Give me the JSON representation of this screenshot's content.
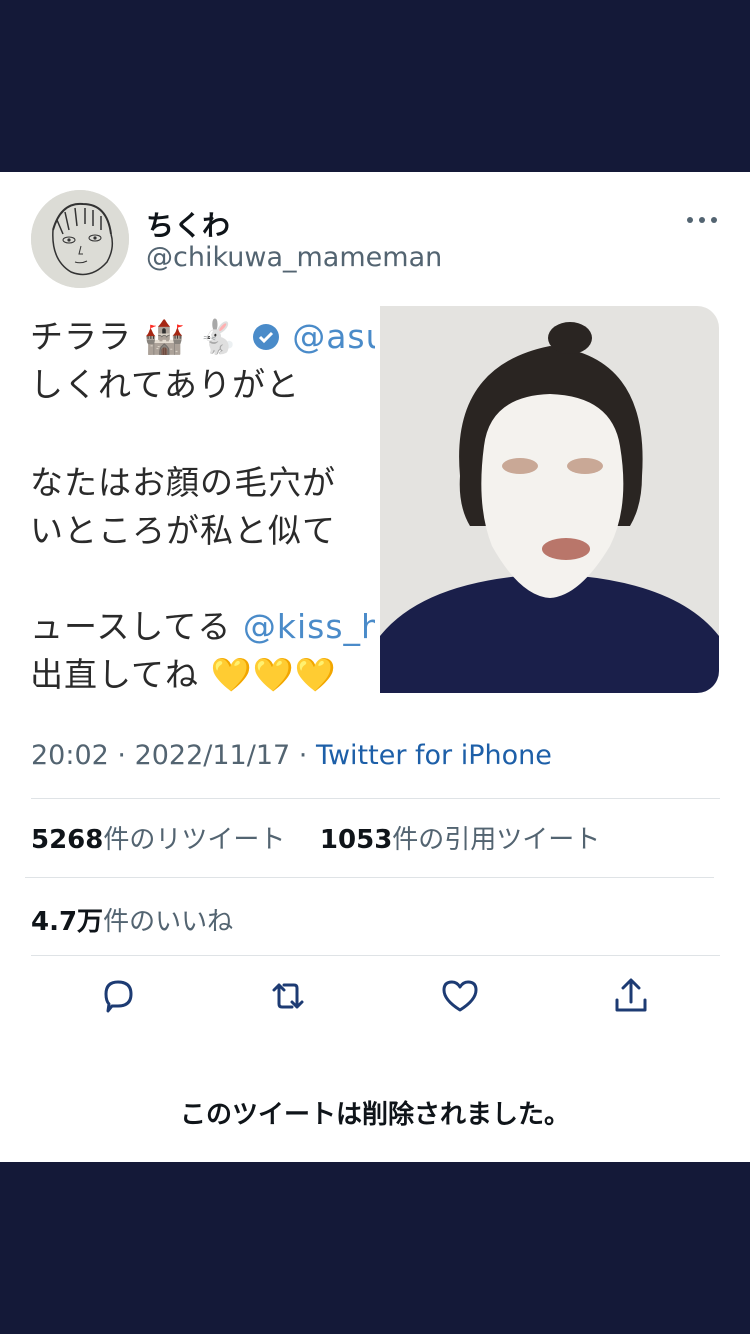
{
  "tweet": {
    "display_name": "ちくわ",
    "handle": "@chikuwa_mameman",
    "time": "20:02",
    "date": "2022/11/17",
    "source": "Twitter for iPhone",
    "separator": " · "
  },
  "screenshot_text": {
    "line1": "チララ",
    "line1_mention": "@asu",
    "line2": "しくれてありがと",
    "line3": "なたはお顔の毛穴が",
    "line4": "いところが私と似て",
    "line5": "ュースしてる",
    "line5_mention": "@kiss_h",
    "line6": "出直してね",
    "hearts": "💛💛💛"
  },
  "stats": {
    "retweets_count": "5268",
    "retweets_label": "件のリツイート",
    "quotes_count": "1053",
    "quotes_label": "件の引用ツイート",
    "likes_count": "4.7万",
    "likes_label": "件のいいね"
  },
  "actions": [
    "reply-icon",
    "retweet-icon",
    "like-icon",
    "share-icon"
  ],
  "deleted_notice": "このツイートは削除されました。",
  "colors": {
    "background": "#141938",
    "card": "#ffffff",
    "text_primary": "#0f1419",
    "text_secondary": "#536471",
    "link": "#1d5fa8",
    "icon": "#1d3b73"
  }
}
